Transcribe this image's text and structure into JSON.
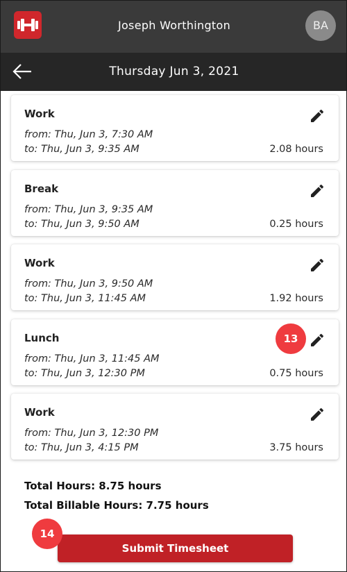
{
  "header": {
    "logo_icon": "dumbbell-logo-icon",
    "user_name": "Joseph Worthington",
    "avatar_initials": "BA"
  },
  "subheader": {
    "back_icon": "arrow-left-icon",
    "date_title": "Thursday Jun 3, 2021"
  },
  "entries": [
    {
      "type": "Work",
      "from": "from: Thu, Jun 3, 7:30 AM",
      "to": "to: Thu, Jun 3, 9:35 AM",
      "hours": "2.08 hours"
    },
    {
      "type": "Break",
      "from": "from: Thu, Jun 3, 9:35 AM",
      "to": "to: Thu, Jun 3, 9:50 AM",
      "hours": "0.25 hours"
    },
    {
      "type": "Work",
      "from": "from: Thu, Jun 3, 9:50 AM",
      "to": "to: Thu, Jun 3, 11:45 AM",
      "hours": "1.92 hours"
    },
    {
      "type": "Lunch",
      "from": "from: Thu, Jun 3, 11:45 AM",
      "to": "to: Thu, Jun 3, 12:30 PM",
      "hours": "0.75 hours"
    },
    {
      "type": "Work",
      "from": "from: Thu, Jun 3, 12:30 PM",
      "to": "to: Thu, Jun 3, 4:15 PM",
      "hours": "3.75 hours"
    }
  ],
  "totals": {
    "total_hours": "Total Hours: 8.75 hours",
    "billable_hours": "Total Billable Hours: 7.75 hours"
  },
  "submit_label": "Submit Timesheet",
  "callouts": {
    "edit_lunch": "13",
    "submit": "14"
  },
  "colors": {
    "header_bg": "#3a3a3a",
    "subheader_bg": "#262626",
    "brand_red": "#d0272c",
    "button_red": "#c02126",
    "callout_red": "#ef3b3f"
  }
}
